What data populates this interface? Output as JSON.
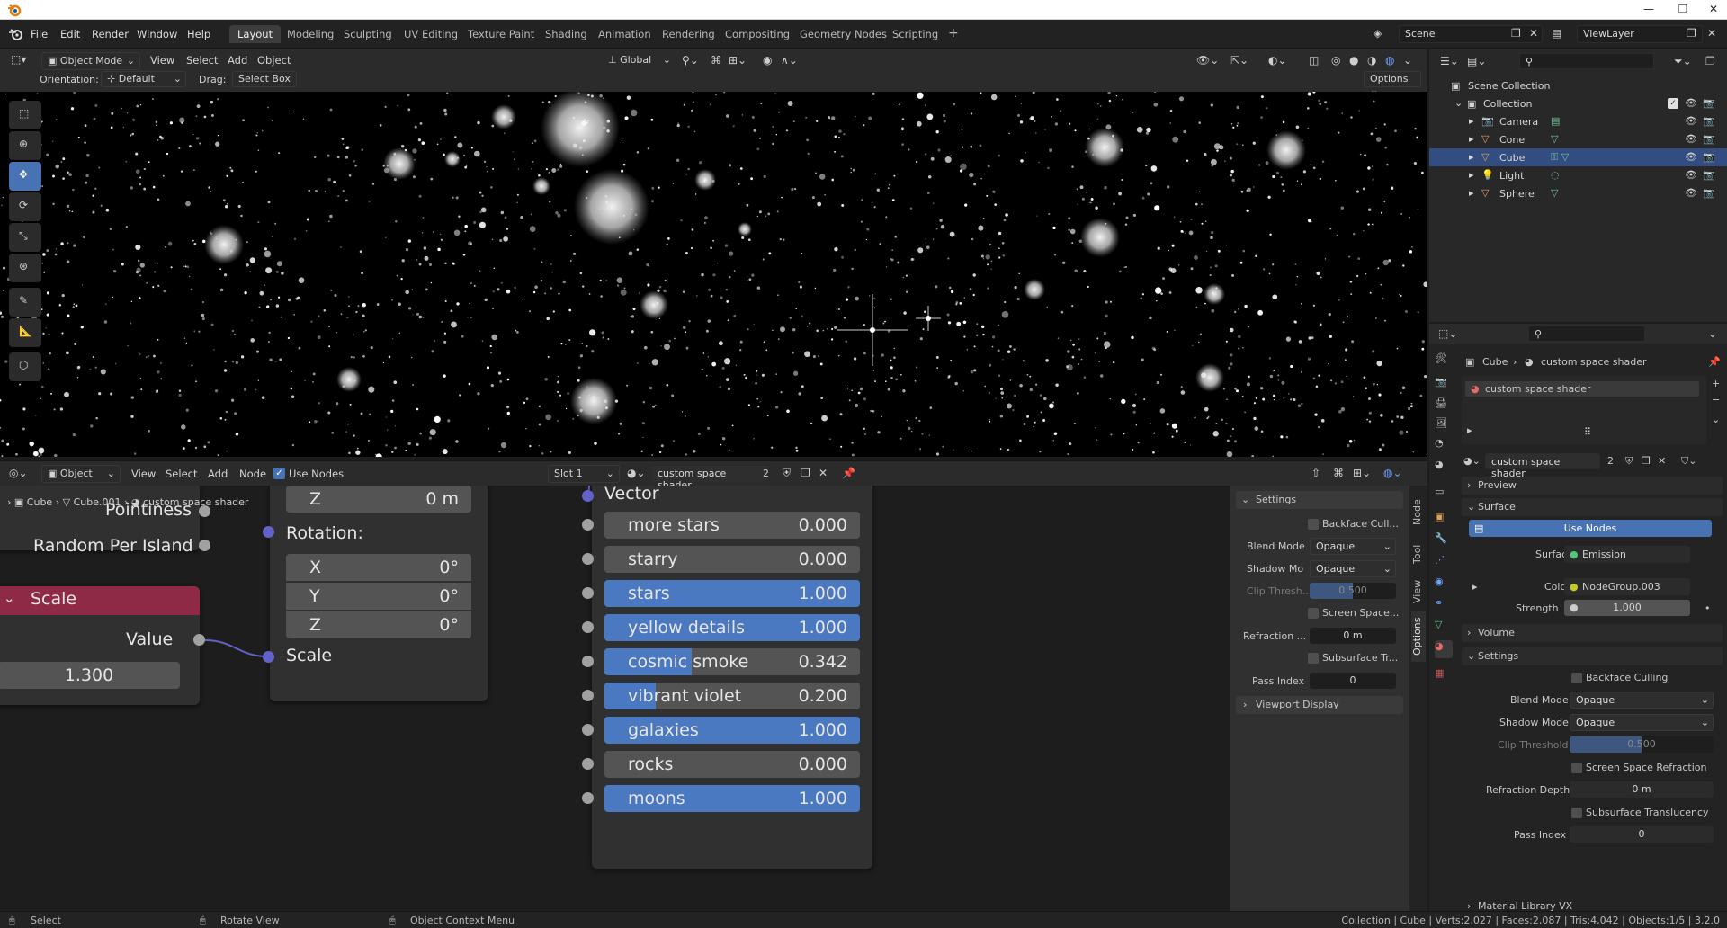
{
  "titlebar": {
    "minimize": "—",
    "maximize": "❐",
    "close": "✕"
  },
  "menu": [
    "File",
    "Edit",
    "Render",
    "Window",
    "Help"
  ],
  "workspaces": [
    {
      "label": "Layout",
      "active": true
    },
    {
      "label": "Modeling"
    },
    {
      "label": "Sculpting"
    },
    {
      "label": "UV Editing"
    },
    {
      "label": "Texture Paint"
    },
    {
      "label": "Shading"
    },
    {
      "label": "Animation"
    },
    {
      "label": "Rendering"
    },
    {
      "label": "Compositing"
    },
    {
      "label": "Geometry Nodes"
    },
    {
      "label": "Scripting"
    }
  ],
  "add_workspace": "+",
  "scene": {
    "name": "Scene",
    "view_layer": "ViewLayer"
  },
  "viewport": {
    "mode": "Object Mode",
    "menus": [
      "View",
      "Select",
      "Add",
      "Object"
    ],
    "transform_orientation": "Global",
    "orientation_label": "Orientation:",
    "orientation_value": "Default",
    "drag_label": "Drag:",
    "drag_value": "Select Box",
    "options_label": "Options"
  },
  "node_editor": {
    "type": "Object",
    "menus": [
      "View",
      "Select",
      "Add",
      "Node"
    ],
    "use_nodes_label": "Use Nodes",
    "slot": "Slot 1",
    "material": "custom space shader",
    "users": "2",
    "breadcrumb": {
      "obj": "Cube",
      "mesh": "Cube.001",
      "mat": "custom space shader"
    },
    "node_left": {
      "pointiness": "Pointiness",
      "random": "Random Per Island",
      "scale_title": "Scale",
      "value_label": "Value",
      "value": "1.300"
    },
    "node_mapping": {
      "z_top_label": "Z",
      "z_top_value": "0 m",
      "rotation_label": "Rotation:",
      "rot": [
        {
          "label": "X",
          "value": "0°"
        },
        {
          "label": "Y",
          "value": "0°"
        },
        {
          "label": "Z",
          "value": "0°"
        }
      ],
      "scale_label": "Scale"
    },
    "node_group": {
      "vector_label": "Vector",
      "inputs": [
        {
          "label": "more stars",
          "value": "0.000",
          "fill": 0.0
        },
        {
          "label": "starry",
          "value": "0.000",
          "fill": 0.0
        },
        {
          "label": "stars",
          "value": "1.000",
          "fill": 1.0
        },
        {
          "label": "yellow details",
          "value": "1.000",
          "fill": 1.0
        },
        {
          "label": "cosmic smoke",
          "value": "0.342",
          "fill": 0.342
        },
        {
          "label": "vibrant violet",
          "value": "0.200",
          "fill": 0.2
        },
        {
          "label": "galaxies",
          "value": "1.000",
          "fill": 1.0
        },
        {
          "label": "rocks",
          "value": "0.000",
          "fill": 0.0
        },
        {
          "label": "moons",
          "value": "1.000",
          "fill": 1.0
        }
      ]
    },
    "side_panel": {
      "settings": "Settings",
      "backface": "Backface Cull...",
      "blend_mode_label": "Blend Mode",
      "blend_mode": "Opaque",
      "shadow_mode_label": "Shadow Mo",
      "shadow_mode": "Opaque",
      "clip_label": "Clip Thresh...",
      "clip_value": "0.500",
      "clip_fill": 0.5,
      "ssr": "Screen Space...",
      "refraction_label": "Refraction ...",
      "refraction_value": "0 m",
      "sss": "Subsurface Tr...",
      "pass_label": "Pass Index",
      "pass_value": "0",
      "viewport_display": "Viewport Display"
    },
    "tabs": [
      "Node",
      "Tool",
      "View",
      "Options"
    ]
  },
  "outliner": {
    "root": "Scene Collection",
    "collection": "Collection",
    "items": [
      {
        "name": "Camera",
        "selected": false,
        "color": "#e0a15a"
      },
      {
        "name": "Cone",
        "selected": false,
        "color": "#e0a15a"
      },
      {
        "name": "Cube",
        "selected": true,
        "color": "#e0a15a"
      },
      {
        "name": "Light",
        "selected": false,
        "color": "#e0a15a"
      },
      {
        "name": "Sphere",
        "selected": false,
        "color": "#e0a15a"
      }
    ]
  },
  "properties": {
    "breadcrumb_obj": "Cube",
    "breadcrumb_mat": "custom space shader",
    "slot_item": "custom space shader",
    "material_name": "custom space shader",
    "users": "2",
    "preview": "Preview",
    "surface_panel": "Surface",
    "use_nodes": "Use Nodes",
    "surface_label": "Surface",
    "surface_value": "Emission",
    "color_label": "Color",
    "color_value": "NodeGroup.003",
    "strength_label": "Strength",
    "strength_value": "1.000",
    "volume": "Volume",
    "settings": "Settings",
    "backface": "Backface Culling",
    "blend_label": "Blend Mode",
    "blend_value": "Opaque",
    "shadow_label": "Shadow Mode",
    "shadow_value": "Opaque",
    "clip_label": "Clip Threshold",
    "clip_value": "0.500",
    "clip_fill": 0.5,
    "ssr": "Screen Space Refraction",
    "refraction_label": "Refraction Depth",
    "refraction_value": "0 m",
    "sss": "Subsurface Translucency",
    "pass_label": "Pass Index",
    "pass_value": "0",
    "material_library": "Material Library VX"
  },
  "statusbar": {
    "select": "Select",
    "rotate": "Rotate View",
    "context": "Object Context Menu",
    "stats": "Collection | Cube | Verts:2,027 | Faces:2,087 | Tris:4,042 | Objects:1/5 | 3.2.0"
  },
  "colors": {
    "accent": "#4772b3",
    "selection": "#334d80",
    "scale_header": "#8e2a46",
    "object_orange": "#e0a15a"
  }
}
